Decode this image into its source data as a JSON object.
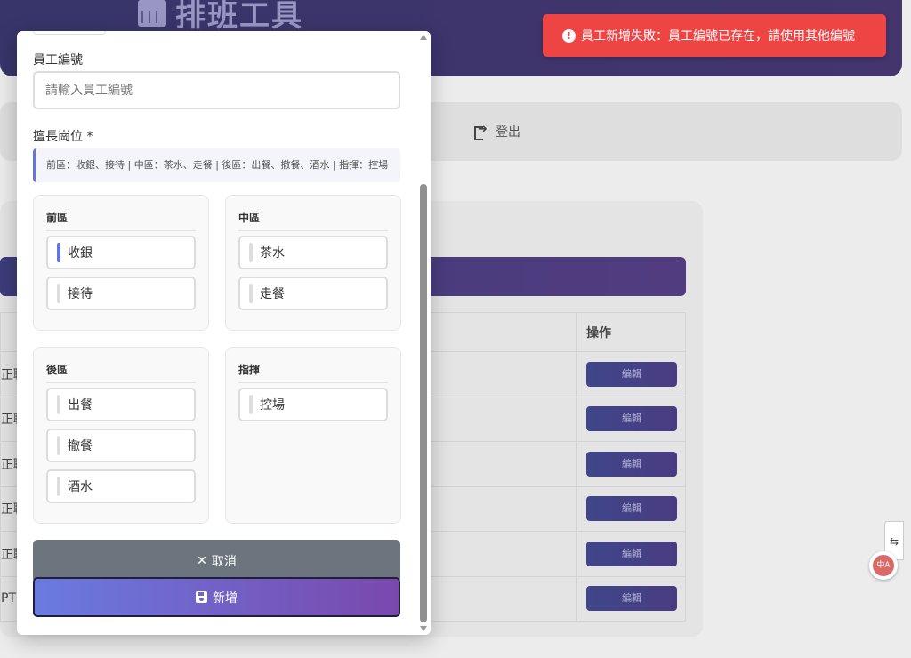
{
  "app": {
    "title": "排班工具"
  },
  "nav": {
    "logout_label": "登出"
  },
  "toast": {
    "icon": "exclamation-circle-icon",
    "message": "員工新增失敗：員工編號已存在，請使用其他編號",
    "color": "#ef4444"
  },
  "table": {
    "col_action": "操作",
    "row_prefixes": [
      "正職",
      "正職",
      "正職",
      "正職",
      "正職",
      "PT"
    ],
    "edit_label": "編輯"
  },
  "modal": {
    "employee_id_label": "員工編號",
    "employee_id_placeholder": "請輸入員工編號",
    "employee_id_value": "",
    "positions_label": "擅長崗位 *",
    "positions_hint": "前區：收銀、接待 | 中區：茶水、走餐 | 後區：出餐、撤餐、酒水 | 指揮：控場",
    "groups": [
      {
        "title": "前區",
        "items": [
          {
            "label": "收銀",
            "selected": true
          },
          {
            "label": "接待",
            "selected": false
          }
        ]
      },
      {
        "title": "中區",
        "items": [
          {
            "label": "茶水",
            "selected": false
          },
          {
            "label": "走餐",
            "selected": false
          }
        ]
      },
      {
        "title": "後區",
        "items": [
          {
            "label": "出餐",
            "selected": false
          },
          {
            "label": "撤餐",
            "selected": false
          },
          {
            "label": "酒水",
            "selected": false
          }
        ]
      },
      {
        "title": "指揮",
        "items": [
          {
            "label": "控場",
            "selected": false
          }
        ]
      }
    ],
    "cancel_label": "取消",
    "submit_label": "新增",
    "accent": "#6575dc"
  },
  "side": {
    "tab_glyph": "⇆",
    "translate_label": "中A"
  }
}
